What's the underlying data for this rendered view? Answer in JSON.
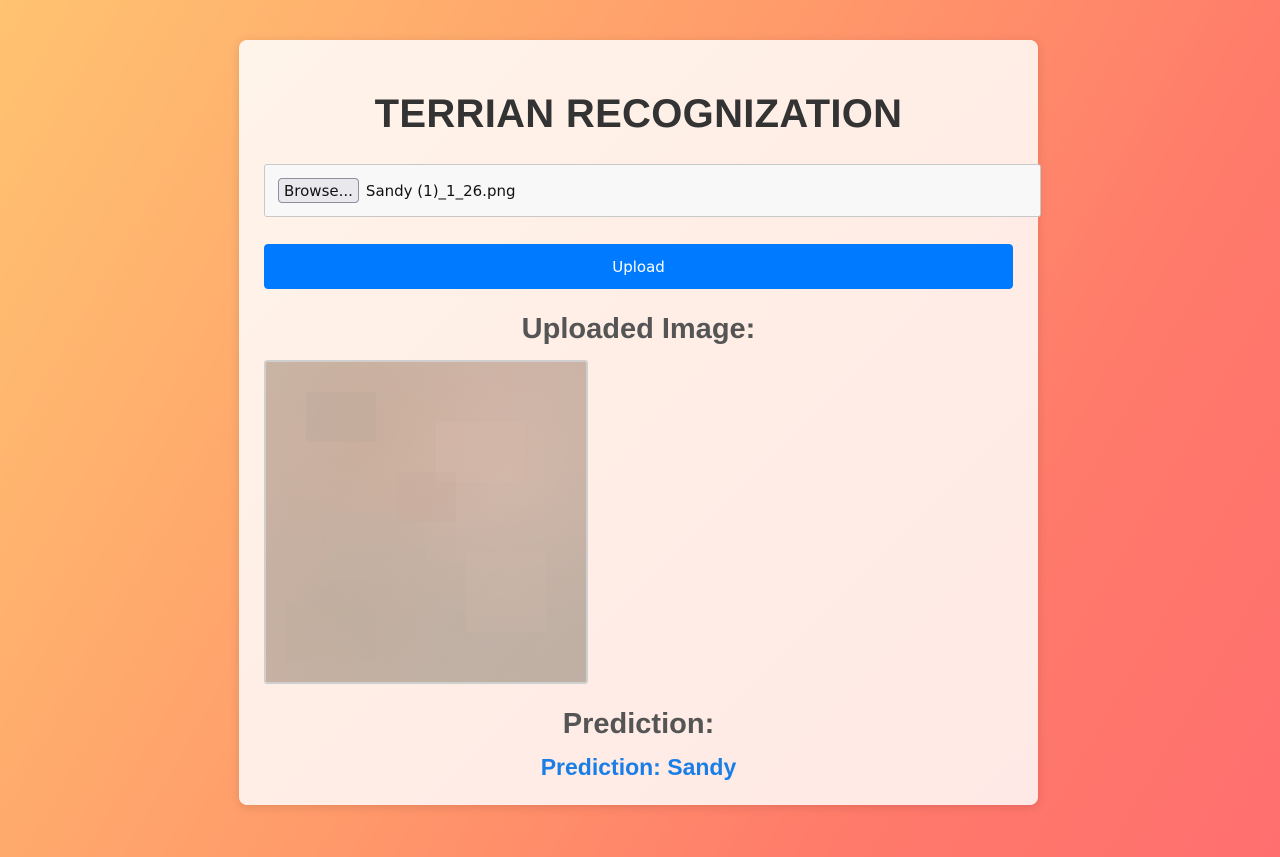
{
  "page": {
    "title": "TERRIAN RECOGNIZATION"
  },
  "upload_form": {
    "browse_label": "Browse...",
    "selected_file": "Sandy (1)_1_26.png",
    "upload_label": "Upload"
  },
  "uploaded_section": {
    "heading": "Uploaded Image:",
    "image_icon": "uploaded-terrain-image"
  },
  "prediction_section": {
    "heading": "Prediction:",
    "result": "Prediction: Sandy"
  },
  "colors": {
    "background_start": "#ffc371",
    "background_end": "#ff6f6f",
    "card": "#fff0e8",
    "title": "#333333",
    "heading": "#555555",
    "upload_button": "#007bff",
    "prediction_text": "#1a7ee6"
  }
}
